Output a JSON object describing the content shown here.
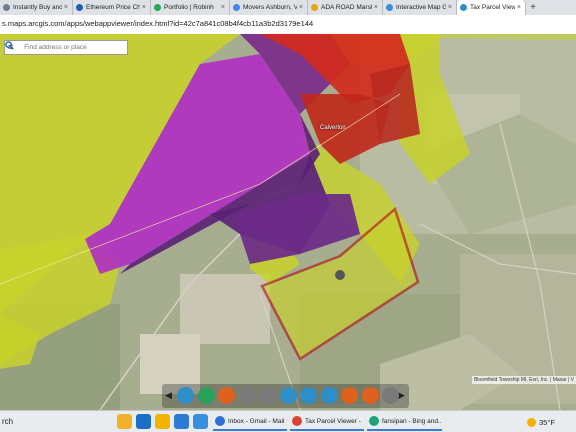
{
  "browser": {
    "tabs": [
      {
        "label": "Instantly Buy and S",
        "icon": "page-icon",
        "color": "#6f7d8c"
      },
      {
        "label": "Ethereum Price Ch",
        "icon": "coin-icon",
        "color": "#1e5bb8"
      },
      {
        "label": "Portfolio | Robinh",
        "icon": "feather-icon",
        "color": "#20a85a"
      },
      {
        "label": "Movers Ashburn, V",
        "icon": "google-icon",
        "color": "#4285f4"
      },
      {
        "label": "ADA ROAD Marsh",
        "icon": "page-icon",
        "color": "#e0a800"
      },
      {
        "label": "Interactive Map Ga",
        "icon": "page-icon",
        "color": "#3b8bd6"
      },
      {
        "label": "Tax Parcel Viewer",
        "icon": "arcgis-icon",
        "color": "#2d8ec8"
      }
    ],
    "active_tab": 6,
    "new_tab_label": "+",
    "url": "s.maps.arcgis.com/apps/webappviewer/index.html?id=42c7a841c08b4f4cb11a3b2d3179e144"
  },
  "map": {
    "search_placeholder": "Find address or place",
    "menu_glyph": "≡",
    "place_label": "Calverton",
    "attribution": "Bloomfield Township MI, Esri, Inc. | Maxar | V",
    "colors": {
      "yellow_green": "#c8d22a",
      "magenta": "#b02dc2",
      "purple": "#5a2074",
      "red": "#d32a1c",
      "selection": "#b01818"
    }
  },
  "toolbar": {
    "prev_glyph": "◀",
    "next_glyph": "▶",
    "tools": [
      {
        "icon": "list-icon",
        "color": "#2d8ec8"
      },
      {
        "icon": "layers-icon",
        "color": "#2aa15a"
      },
      {
        "icon": "basemap-icon",
        "color": "#e0601e"
      },
      {
        "icon": "table-icon",
        "color": "#7a7a7a"
      },
      {
        "icon": "query-icon",
        "color": "#7a7a7a"
      },
      {
        "icon": "gear-icon",
        "color": "#2d8ec8"
      },
      {
        "icon": "measure-icon",
        "color": "#2d8ec8"
      },
      {
        "icon": "draw-icon",
        "color": "#2d8ec8"
      },
      {
        "icon": "info-icon",
        "color": "#e0601e"
      },
      {
        "icon": "print-icon",
        "color": "#e0601e"
      },
      {
        "icon": "bookmark-icon",
        "color": "#7a7a7a"
      }
    ]
  },
  "taskbar": {
    "search_text": "rch",
    "apps": [
      {
        "label": "Inbox - Gmail - Mail",
        "icon": "mail-icon",
        "color": "#2d6fd4"
      },
      {
        "label": "Tax Parcel Viewer -",
        "icon": "chrome-icon",
        "color": "#db4437"
      },
      {
        "label": "fansipan - Bing and...",
        "icon": "edge-icon",
        "color": "#1fa37a"
      }
    ],
    "weather": "35°F"
  }
}
